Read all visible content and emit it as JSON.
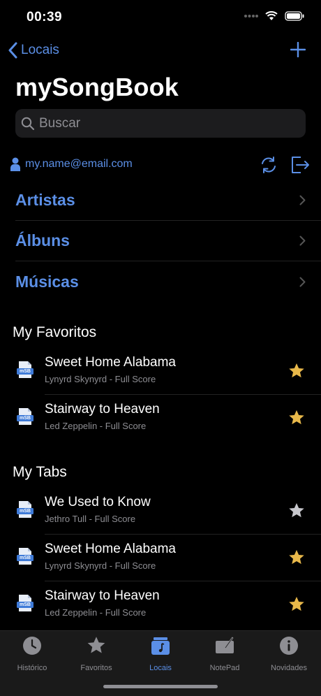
{
  "status": {
    "time": "00:39"
  },
  "nav": {
    "back_label": "Locais"
  },
  "title": "mySongBook",
  "search": {
    "placeholder": "Buscar"
  },
  "account": {
    "email": "my.name@email.com"
  },
  "menu": [
    {
      "label": "Artistas"
    },
    {
      "label": "Álbuns"
    },
    {
      "label": "Músicas"
    }
  ],
  "favorites": {
    "header": "My Favoritos",
    "items": [
      {
        "title": "Sweet Home Alabama",
        "subtitle": "Lynyrd Skynyrd - Full Score",
        "favorite": true
      },
      {
        "title": "Stairway to Heaven",
        "subtitle": "Led Zeppelin - Full Score",
        "favorite": true
      }
    ]
  },
  "tabs_section": {
    "header": "My Tabs",
    "items": [
      {
        "title": "We Used to Know",
        "subtitle": "Jethro Tull - Full Score",
        "favorite": false
      },
      {
        "title": "Sweet Home Alabama",
        "subtitle": "Lynyrd Skynyrd - Full Score",
        "favorite": true
      },
      {
        "title": "Stairway to Heaven",
        "subtitle": "Led Zeppelin - Full Score",
        "favorite": true
      }
    ]
  },
  "file_icon_text": "mSB",
  "tabbar": [
    {
      "label": "Histórico",
      "icon": "clock-icon",
      "active": false
    },
    {
      "label": "Favoritos",
      "icon": "star-icon",
      "active": false
    },
    {
      "label": "Locais",
      "icon": "folder-music-icon",
      "active": true
    },
    {
      "label": "NotePad",
      "icon": "notepad-icon",
      "active": false
    },
    {
      "label": "Novidades",
      "icon": "info-icon",
      "active": false
    }
  ],
  "colors": {
    "accent": "#5b8fe6",
    "star_on": "#e8b84a",
    "star_off": "#c7c7cc",
    "background": "#000000"
  }
}
